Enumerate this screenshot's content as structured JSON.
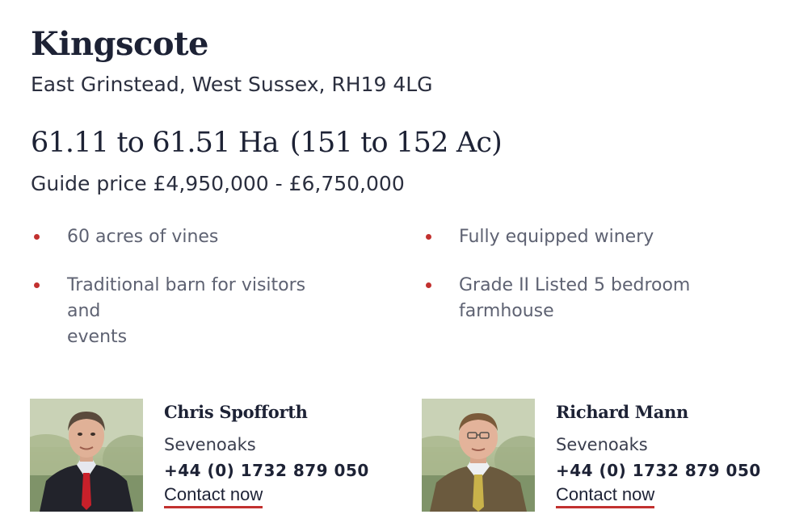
{
  "property": {
    "name": "Kingscote",
    "address": "East Grinstead, West Sussex, RH19 4LG",
    "area_ha": "61.11 to 61.51 Ha",
    "area_ac": "(151 to 152 Ac)",
    "guide_price": "Guide price £4,950,000 - £6,750,000"
  },
  "features": [
    {
      "line1": "60 acres of vines"
    },
    {
      "line1": "Fully equipped winery"
    },
    {
      "line1": "Traditional barn for visitors",
      "line2": "and",
      "line3": "events"
    },
    {
      "line1": "Grade II Listed 5 bedroom",
      "line2": "farmhouse"
    }
  ],
  "agents": [
    {
      "name": "Chris Spofforth",
      "office": "Sevenoaks",
      "phone": "+44 (0) 1732 879 050",
      "contact_label": "Contact now",
      "tie_color": "#c8202a"
    },
    {
      "name": "Richard Mann",
      "office": "Sevenoaks",
      "phone": "+44 (0) 1732 879 050",
      "contact_label": "Contact now",
      "tie_color": "#c9b24a"
    }
  ],
  "colors": {
    "accent": "#c2312f",
    "text_dark": "#1d2235",
    "text_muted": "#5e6272"
  }
}
